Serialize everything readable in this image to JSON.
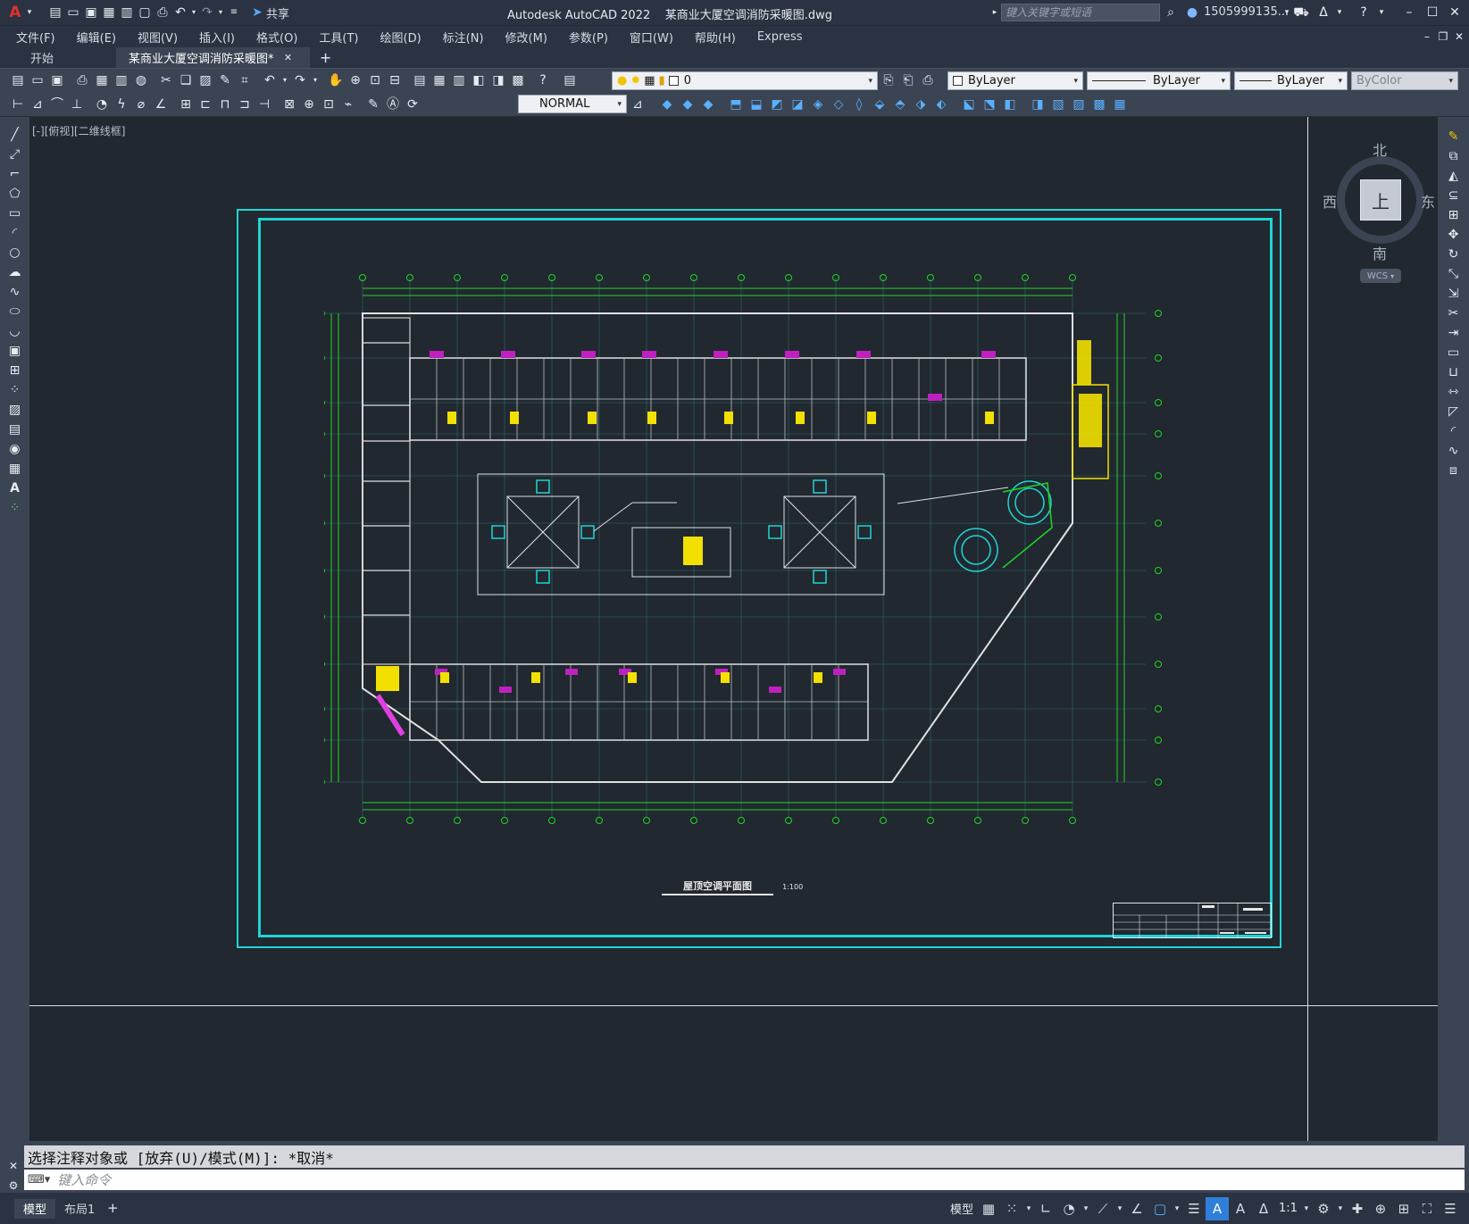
{
  "app": {
    "title": "Autodesk AutoCAD 2022",
    "filename": "某商业大厦空调消防采暖图.dwg"
  },
  "titlebar": {
    "share_label": "共享",
    "search_placeholder": "键入关键字或短语",
    "user": "1505999135..."
  },
  "menus": [
    "文件(F)",
    "编辑(E)",
    "视图(V)",
    "插入(I)",
    "格式(O)",
    "工具(T)",
    "绘图(D)",
    "标注(N)",
    "修改(M)",
    "参数(P)",
    "窗口(W)",
    "帮助(H)",
    "Express"
  ],
  "tabs": {
    "start": "开始",
    "document": "某商业大厦空调消防采暖图*",
    "add": "+"
  },
  "toolbar1": {
    "layer_value": "0",
    "color_value": "ByLayer",
    "linetype_value": "ByLayer",
    "lineweight_value": "ByLayer",
    "plotstyle_value": "ByColor"
  },
  "toolbar2": {
    "textstyle_value": "NORMAL"
  },
  "viewport": {
    "label": "[-][俯视][二维线框]"
  },
  "viewcube": {
    "north": "北",
    "south": "南",
    "east": "东",
    "west": "西",
    "face": "上",
    "wcs": "WCS"
  },
  "drawing": {
    "title": "屋顶空调平面图",
    "scale": "1:100"
  },
  "command": {
    "history_line": "选择注释对象或 [放弃(U)/模式(M)]: *取消*",
    "input_placeholder": "键入命令"
  },
  "status": {
    "model_tab": "模型",
    "layout_tab": "布局1",
    "add": "+",
    "model_label": "模型",
    "scale": "1:1"
  }
}
